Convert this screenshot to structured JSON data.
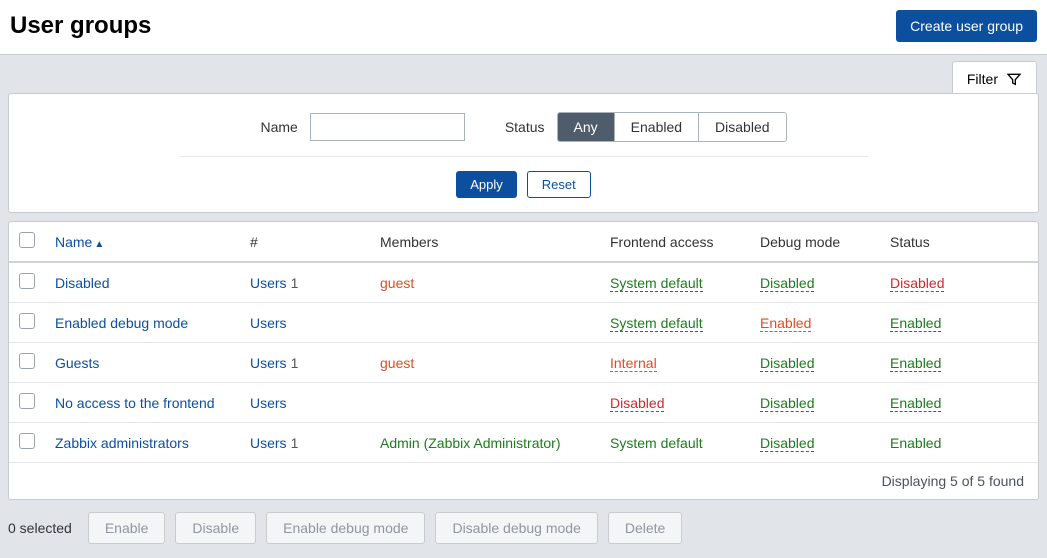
{
  "header": {
    "title": "User groups",
    "create_btn": "Create user group"
  },
  "filter": {
    "tab_label": "Filter",
    "name_label": "Name",
    "name_value": "",
    "status_label": "Status",
    "status_options": {
      "any": "Any",
      "enabled": "Enabled",
      "disabled": "Disabled"
    },
    "status_selected": "any",
    "apply": "Apply",
    "reset": "Reset"
  },
  "table": {
    "headers": {
      "name": "Name",
      "hash": "#",
      "members": "Members",
      "frontend": "Frontend access",
      "debug": "Debug mode",
      "status": "Status"
    },
    "rows": [
      {
        "name": "Disabled",
        "users_label": "Users",
        "users_count": "1",
        "members": "guest",
        "members_color": "orange-red",
        "frontend": "System default",
        "frontend_color": "green",
        "debug": "Disabled",
        "debug_color": "green",
        "status": "Disabled",
        "status_color": "red"
      },
      {
        "name": "Enabled debug mode",
        "users_label": "Users",
        "users_count": "",
        "members": "",
        "members_color": "",
        "frontend": "System default",
        "frontend_color": "green",
        "debug": "Enabled",
        "debug_color": "orange-red",
        "status": "Enabled",
        "status_color": "green"
      },
      {
        "name": "Guests",
        "users_label": "Users",
        "users_count": "1",
        "members": "guest",
        "members_color": "orange-red",
        "frontend": "Internal",
        "frontend_color": "orange-red",
        "debug": "Disabled",
        "debug_color": "green",
        "status": "Enabled",
        "status_color": "green"
      },
      {
        "name": "No access to the frontend",
        "users_label": "Users",
        "users_count": "",
        "members": "",
        "members_color": "",
        "frontend": "Disabled",
        "frontend_color": "red",
        "debug": "Disabled",
        "debug_color": "green",
        "status": "Enabled",
        "status_color": "green"
      },
      {
        "name": "Zabbix administrators",
        "users_label": "Users",
        "users_count": "1",
        "members": "Admin (Zabbix Administrator)",
        "members_color": "green",
        "frontend": "System default",
        "frontend_color": "green",
        "debug": "Disabled",
        "debug_color": "green",
        "status": "Enabled",
        "status_color": "green"
      }
    ],
    "footer": "Displaying 5 of 5 found"
  },
  "bulk": {
    "selected": "0 selected",
    "enable": "Enable",
    "disable": "Disable",
    "enable_debug": "Enable debug mode",
    "disable_debug": "Disable debug mode",
    "delete": "Delete"
  }
}
